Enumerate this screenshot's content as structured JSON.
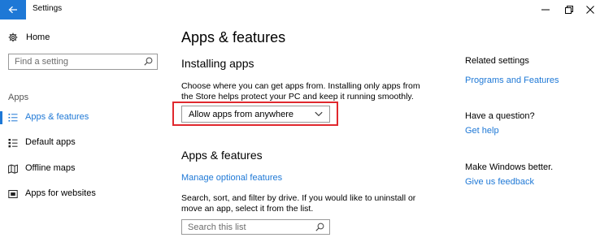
{
  "window": {
    "title": "Settings"
  },
  "sidebar": {
    "home_label": "Home",
    "search_placeholder": "Find a setting",
    "section_label": "Apps",
    "items": [
      {
        "label": "Apps & features",
        "icon": "list-icon",
        "active": true
      },
      {
        "label": "Default apps",
        "icon": "default-apps-icon",
        "active": false
      },
      {
        "label": "Offline maps",
        "icon": "map-icon",
        "active": false
      },
      {
        "label": "Apps for websites",
        "icon": "apps-for-websites-icon",
        "active": false
      }
    ]
  },
  "main": {
    "title": "Apps & features",
    "installing": {
      "heading": "Installing apps",
      "description": "Choose where you can get apps from. Installing only apps from the Store helps protect your PC and keep it running smoothly.",
      "dropdown_value": "Allow apps from anywhere"
    },
    "apps_features": {
      "heading": "Apps & features",
      "link": "Manage optional features",
      "description": "Search, sort, and filter by drive. If you would like to uninstall or move an app, select it from the list.",
      "search_placeholder": "Search this list"
    }
  },
  "related": {
    "heading": "Related settings",
    "link": "Programs and Features",
    "question_heading": "Have a question?",
    "question_link": "Get help",
    "feedback_heading": "Make Windows better.",
    "feedback_link": "Give us feedback"
  },
  "colors": {
    "accent": "#1e78d6",
    "highlight": "#e0282e"
  }
}
